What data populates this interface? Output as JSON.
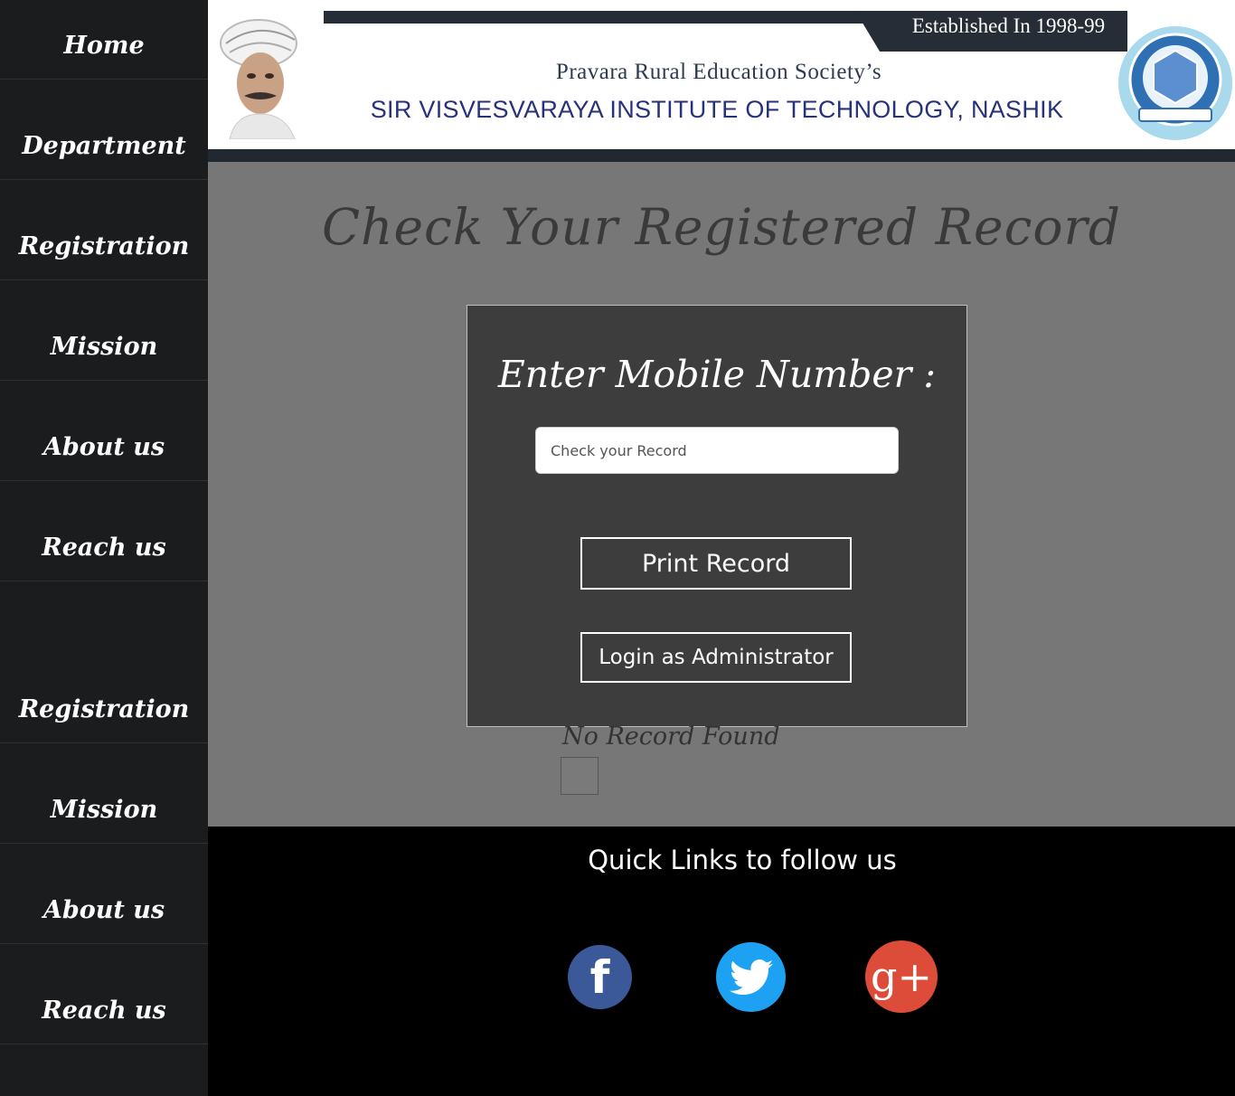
{
  "sidebar": {
    "items": [
      {
        "label": "Home"
      },
      {
        "label": "Department"
      },
      {
        "label": "Registration"
      },
      {
        "label": "Mission"
      },
      {
        "label": "About us"
      },
      {
        "label": "Reach us"
      },
      {
        "label": "Registration"
      },
      {
        "label": "Mission"
      },
      {
        "label": "About us"
      },
      {
        "label": "Reach us"
      }
    ]
  },
  "header": {
    "established": "Established In 1998-99",
    "society": "Pravara Rural Education Society’s",
    "institute": "SIR VISVESVARAYA INSTITUTE OF TECHNOLOGY, NASHIK"
  },
  "main": {
    "title": "Check Your Registered Record",
    "form": {
      "label": "Enter Mobile Number :",
      "input_placeholder": "Check your Record",
      "input_value": "",
      "print_button": "Print Record",
      "admin_button": "Login as Administrator"
    },
    "status": "No Record Found"
  },
  "footer": {
    "title": "Quick Links to follow us",
    "social": [
      {
        "name": "facebook",
        "icon": "facebook-icon",
        "color": "#3b5998",
        "glyph": "f"
      },
      {
        "name": "twitter",
        "icon": "twitter-icon",
        "color": "#1da1f2"
      },
      {
        "name": "google-plus",
        "icon": "google-plus-icon",
        "color": "#dd4b39",
        "glyph": "g+"
      }
    ]
  }
}
